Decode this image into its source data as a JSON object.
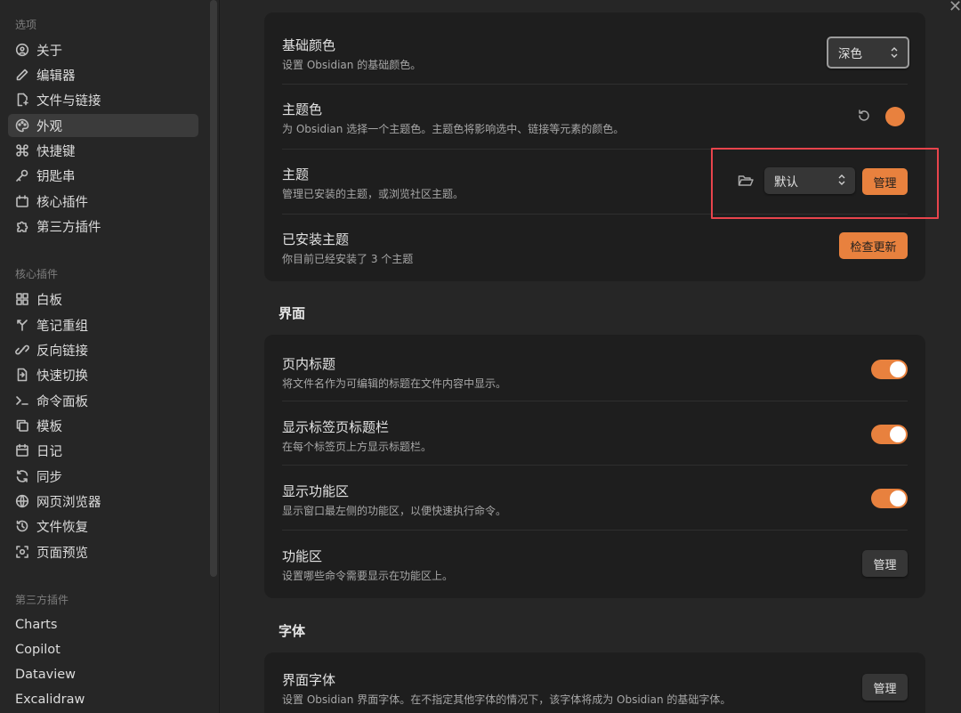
{
  "sidebar": {
    "options_header": "选项",
    "options": [
      {
        "label": "关于",
        "icon": "info-circle-icon"
      },
      {
        "label": "编辑器",
        "icon": "pencil-icon"
      },
      {
        "label": "文件与链接",
        "icon": "file-link-icon"
      },
      {
        "label": "外观",
        "icon": "palette-icon",
        "active": true
      },
      {
        "label": "快捷键",
        "icon": "command-icon"
      },
      {
        "label": "钥匙串",
        "icon": "key-icon"
      },
      {
        "label": "核心插件",
        "icon": "calendar-plug-icon"
      },
      {
        "label": "第三方插件",
        "icon": "puzzle-icon"
      }
    ],
    "core_header": "核心插件",
    "core": [
      {
        "label": "白板",
        "icon": "layout-grid-icon"
      },
      {
        "label": "笔记重组",
        "icon": "merge-icon"
      },
      {
        "label": "反向链接",
        "icon": "backlink-icon"
      },
      {
        "label": "快速切换",
        "icon": "file-switch-icon"
      },
      {
        "label": "命令面板",
        "icon": "terminal-icon"
      },
      {
        "label": "模板",
        "icon": "copy-icon"
      },
      {
        "label": "日记",
        "icon": "calendar-icon"
      },
      {
        "label": "同步",
        "icon": "refresh-icon"
      },
      {
        "label": "网页浏览器",
        "icon": "globe-icon"
      },
      {
        "label": "文件恢复",
        "icon": "history-icon"
      },
      {
        "label": "页面预览",
        "icon": "preview-icon"
      }
    ],
    "third_header": "第三方插件",
    "third": [
      {
        "label": "Charts"
      },
      {
        "label": "Copilot"
      },
      {
        "label": "Dataview"
      },
      {
        "label": "Excalidraw"
      }
    ]
  },
  "appearance": {
    "base_color": {
      "title": "基础颜色",
      "desc": "设置 Obsidian 的基础颜色。",
      "value": "深色"
    },
    "accent_color": {
      "title": "主题色",
      "desc": "为 Obsidian 选择一个主题色。主题色将影响选中、链接等元素的颜色。",
      "color": "#e8813e"
    },
    "theme": {
      "title": "主题",
      "desc": "管理已安装的主题，或浏览社区主题。",
      "value": "默认",
      "manage": "管理"
    },
    "installed": {
      "title": "已安装主题",
      "desc": "你目前已经安装了 3 个主题",
      "button": "检查更新"
    }
  },
  "interface": {
    "header": "界面",
    "inline_title": {
      "title": "页内标题",
      "desc": "将文件名作为可编辑的标题在文件内容中显示。",
      "on": true
    },
    "tab_title_bar": {
      "title": "显示标签页标题栏",
      "desc": "在每个标签页上方显示标题栏。",
      "on": true
    },
    "ribbon": {
      "title": "显示功能区",
      "desc": "显示窗口最左侧的功能区，以便快速执行命令。",
      "on": true
    },
    "ribbon_manage": {
      "title": "功能区",
      "desc": "设置哪些命令需要显示在功能区上。",
      "button": "管理"
    }
  },
  "font": {
    "header": "字体",
    "interface_font": {
      "title": "界面字体",
      "desc": "设置 Obsidian 界面字体。在不指定其他字体的情况下，该字体将成为 Obsidian 的基础字体。",
      "button": "管理"
    }
  },
  "colors": {
    "accent": "#e8813e",
    "highlight": "#e8444c"
  }
}
